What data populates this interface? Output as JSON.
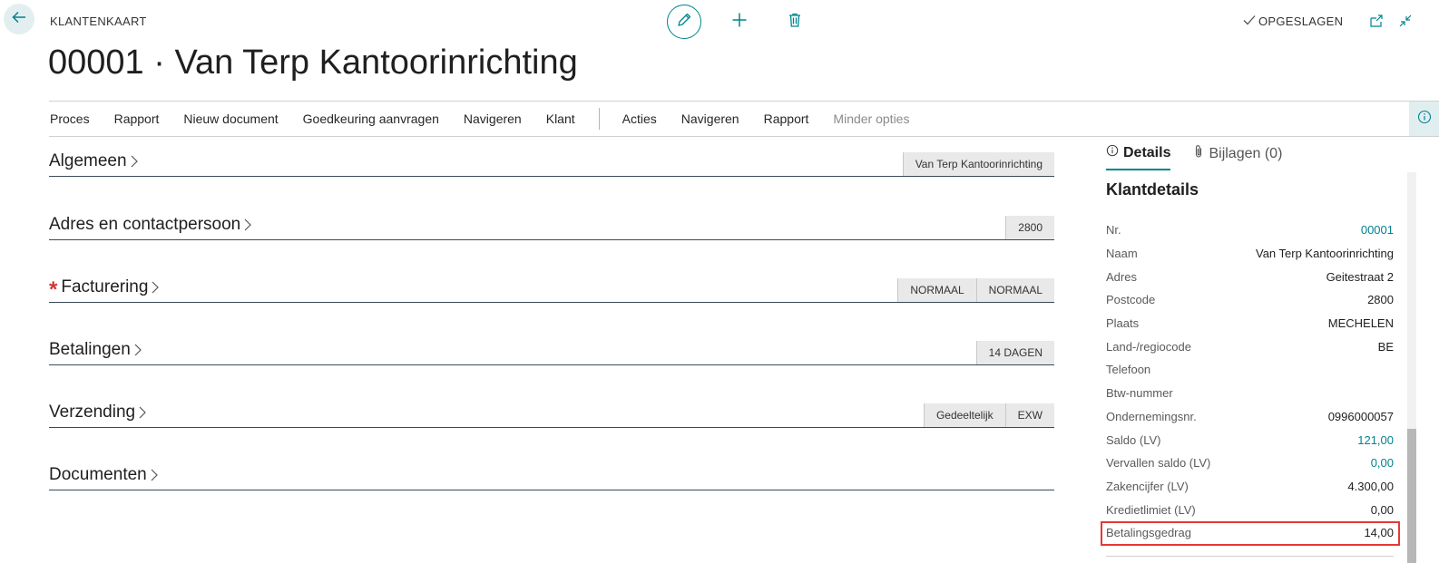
{
  "header": {
    "caption": "KLANTENKAART",
    "title": "00001 · Van Terp Kantoorinrichting",
    "saved_label": "OPGESLAGEN"
  },
  "actions": [
    "Proces",
    "Rapport",
    "Nieuw document",
    "Goedkeuring aanvragen",
    "Navigeren",
    "Klant"
  ],
  "actions2": [
    "Acties",
    "Navigeren",
    "Rapport",
    "Minder opties"
  ],
  "fasttabs": [
    {
      "title": "Algemeen",
      "required": false,
      "summary": [
        "Van Terp Kantoorinrichting"
      ]
    },
    {
      "title": "Adres en contactpersoon",
      "required": false,
      "summary": [
        "2800"
      ]
    },
    {
      "title": "Facturering",
      "required": true,
      "summary": [
        "NORMAAL",
        "NORMAAL"
      ]
    },
    {
      "title": "Betalingen",
      "required": false,
      "summary": [
        "14 DAGEN"
      ]
    },
    {
      "title": "Verzending",
      "required": false,
      "summary": [
        "Gedeeltelijk",
        "EXW"
      ]
    },
    {
      "title": "Documenten",
      "required": false,
      "summary": []
    }
  ],
  "factbox": {
    "tabs": [
      {
        "label": "Details",
        "active": true
      },
      {
        "label": "Bijlagen (0)",
        "active": false
      }
    ],
    "heading": "Klantdetails",
    "rows": [
      {
        "label": "Nr.",
        "value": "00001",
        "link": true
      },
      {
        "label": "Naam",
        "value": "Van Terp Kantoorinrichting",
        "link": false
      },
      {
        "label": "Adres",
        "value": "Geitestraat 2",
        "link": false
      },
      {
        "label": "Postcode",
        "value": "2800",
        "link": false
      },
      {
        "label": "Plaats",
        "value": "MECHELEN",
        "link": false
      },
      {
        "label": "Land-/regiocode",
        "value": "BE",
        "link": false
      },
      {
        "label": "Telefoon",
        "value": "",
        "link": false
      },
      {
        "label": "Btw-nummer",
        "value": "",
        "link": false
      },
      {
        "label": "Ondernemingsnr.",
        "value": "0996000057",
        "link": false
      },
      {
        "label": "Saldo (LV)",
        "value": "121,00",
        "link": true
      },
      {
        "label": "Vervallen saldo (LV)",
        "value": "0,00",
        "link": true
      },
      {
        "label": "Zakencijfer (LV)",
        "value": "4.300,00",
        "link": false
      },
      {
        "label": "Kredietlimiet (LV)",
        "value": "0,00",
        "link": false
      },
      {
        "label": "Betalingsgedrag",
        "value": "14,00",
        "link": false
      }
    ]
  },
  "colors": {
    "accent": "#00838f",
    "required": "#d13438",
    "highlight": "#e53935"
  },
  "icons": [
    "back-arrow-icon",
    "pencil-icon",
    "plus-icon",
    "trash-icon",
    "checkmark-icon",
    "open-new-window-icon",
    "collapse-icon",
    "info-icon",
    "chevron-right-icon",
    "paperclip-icon"
  ]
}
